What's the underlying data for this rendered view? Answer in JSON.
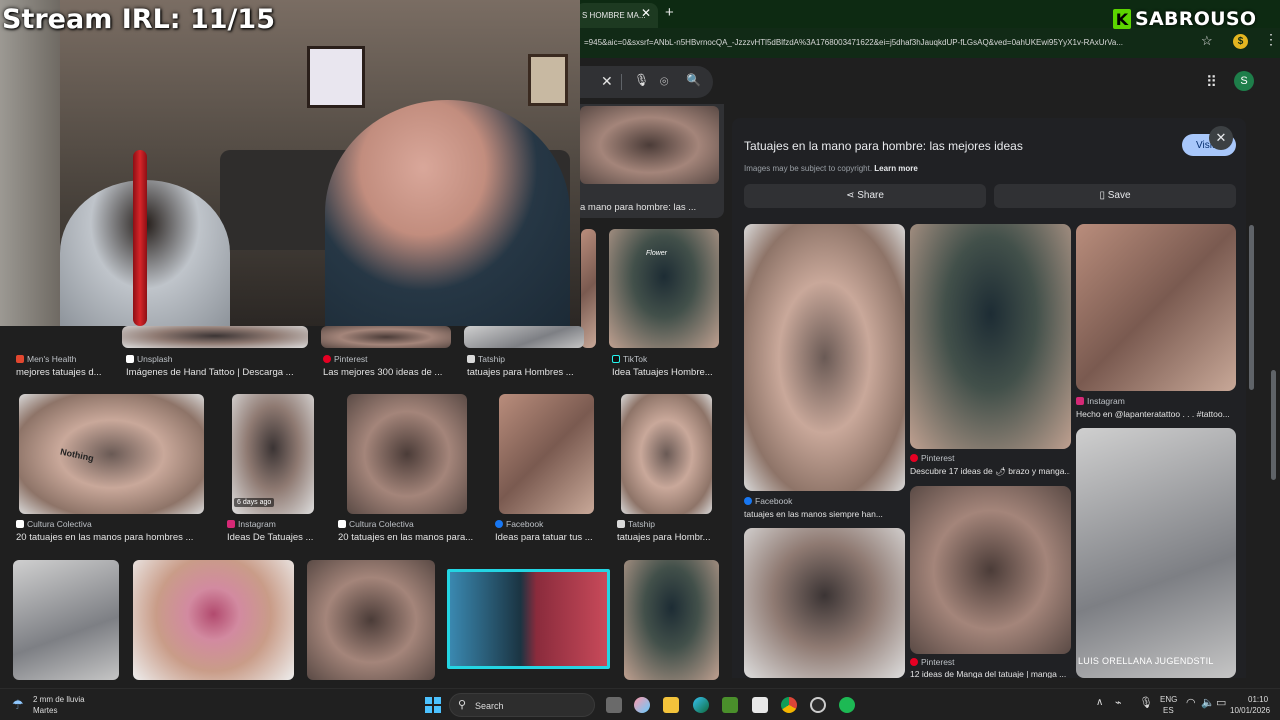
{
  "browser": {
    "tab_title": "S HOMBRE MA...",
    "url": "=945&aic=0&sxsrf=ANbL-n5HBvrnocQA_-JzzzvHTl5dBlfzdA%3A1768003471622&ei=j5dhaf3hJauqkdUP-fLGsAQ&ved=0ahUKEwi95YyX1v-RAxUrVa...",
    "tab_close_glyph": "✕",
    "new_tab_glyph": "+"
  },
  "overlay": {
    "stream_title": "Stream IRL: 11/15",
    "brand_k": "K",
    "brand_name": "SABROUSO"
  },
  "header": {
    "clear_glyph": "✕",
    "mic_glyph": "🎙",
    "lens_glyph": "⌾",
    "search_glyph": "🔍",
    "apps_glyph": "⠿",
    "avatar_letter": "S"
  },
  "peek_card": {
    "caption": "a mano para hombre: las ..."
  },
  "row1": [
    {
      "source": "Men's Health",
      "caption": "mejores tatuajes d...",
      "color": "#e2472f"
    },
    {
      "source": "Unsplash",
      "caption": "Imágenes de Hand Tattoo | Descarga ...",
      "color": "#ffffff"
    },
    {
      "source": "Pinterest",
      "caption": "Las mejores 300 ideas de ...",
      "color": "#e60023"
    },
    {
      "source": "Tatship",
      "caption": "tatuajes para Hombres ...",
      "color": "#d9d9d9"
    },
    {
      "source": "TikTok",
      "caption": "Idea Tatuajes Hombre...",
      "color": "#111111"
    }
  ],
  "row2": [
    {
      "source": "Cultura Colectiva",
      "caption": "20 tatuajes en las manos para hombres ...",
      "color": "#ffffff"
    },
    {
      "source": "Instagram",
      "caption": "Ideas De Tatuajes ...",
      "color": "#d62976",
      "badge": "6 days ago"
    },
    {
      "source": "Cultura Colectiva",
      "caption": "20 tatuajes en las manos para...",
      "color": "#ffffff"
    },
    {
      "source": "Facebook",
      "caption": "Ideas para tatuar tus ...",
      "color": "#1877f2"
    },
    {
      "source": "Tatship",
      "caption": "tatuajes para Hombr...",
      "color": "#d9d9d9"
    }
  ],
  "panel": {
    "title": "Tatuajes en la mano para hombre: las mejores ideas",
    "visit_label": "Visit",
    "close_glyph": "✕",
    "copyright": "Images may be subject to copyright.",
    "learn_more": "Learn more",
    "share_label": "Share",
    "save_label": "Save",
    "related": [
      {
        "source": "Facebook",
        "caption": "tatuajes en las manos siempre han...",
        "color": "#1877f2"
      },
      {
        "source": "Pinterest",
        "caption": "Descubre 17 ideas de 🌶 brazo y manga...",
        "color": "#e60023"
      },
      {
        "source": "Instagram",
        "caption": "Hecho en @lapanteratattoo . . . #tattoo...",
        "color": "#d62976"
      },
      {
        "source": "Pinterest",
        "caption": "12 ideas de Manga del tatuaje | manga ...",
        "color": "#e60023"
      }
    ],
    "watermark": "LUIS ORELLANA JUGENDSTIL",
    "tattoo_text": "Nothing",
    "flower_label": "Flower"
  },
  "taskbar": {
    "weather_temp": "2 mm de lluvia",
    "weather_day": "Martes",
    "search_label": "Search",
    "lang_top": "ENG",
    "lang_bottom": "ES",
    "time": "01:10",
    "date": "10/01/2026"
  }
}
